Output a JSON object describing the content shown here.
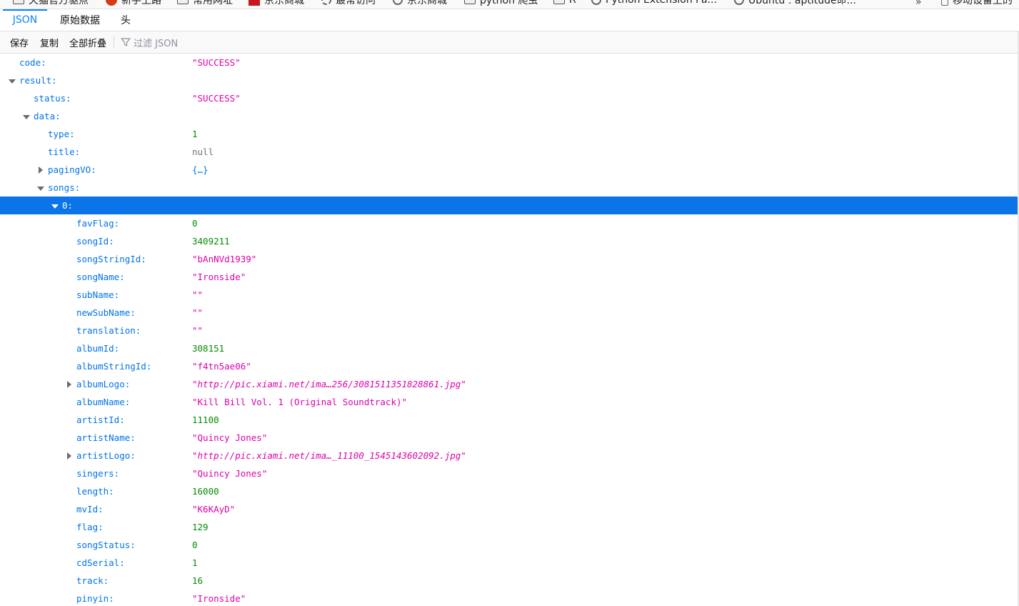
{
  "bookmarks": {
    "items": [
      {
        "label": "天猫官方驱点",
        "icon": "folder-icon"
      },
      {
        "label": "新手上路",
        "icon": "firefox-icon"
      },
      {
        "label": "常用网址",
        "icon": "folder-icon"
      },
      {
        "label": "京东商城",
        "icon": "jd-icon"
      },
      {
        "label": "最常访问",
        "icon": "gear-icon"
      },
      {
        "label": "京东商城",
        "icon": "globe-icon"
      },
      {
        "label": "python 爬虫",
        "icon": "folder-icon"
      },
      {
        "label": "R",
        "icon": "folder-icon"
      },
      {
        "label": "Python Extension Pa...",
        "icon": "globe-icon"
      },
      {
        "label": "Ubuntu : aptitude命...",
        "icon": "globe-icon"
      },
      {
        "label": "移动设备上的",
        "icon": "phone-icon"
      }
    ]
  },
  "tabs": [
    {
      "label": "JSON",
      "active": true
    },
    {
      "label": "原始数据",
      "active": false
    },
    {
      "label": "头",
      "active": false
    }
  ],
  "toolbar": {
    "save": "保存",
    "copy": "复制",
    "collapse_all": "全部折叠",
    "filter_placeholder": "过滤 JSON"
  },
  "rows": [
    {
      "key": "code:",
      "value": "\"SUCCESS\"",
      "type": "str",
      "depth": 0,
      "twisty": "none"
    },
    {
      "key": "result:",
      "value": "",
      "type": "",
      "depth": 0,
      "twisty": "open"
    },
    {
      "key": "status:",
      "value": "\"SUCCESS\"",
      "type": "str",
      "depth": 1,
      "twisty": "none"
    },
    {
      "key": "data:",
      "value": "",
      "type": "",
      "depth": 1,
      "twisty": "open"
    },
    {
      "key": "type:",
      "value": "1",
      "type": "num",
      "depth": 2,
      "twisty": "none"
    },
    {
      "key": "title:",
      "value": "null",
      "type": "null",
      "depth": 2,
      "twisty": "none"
    },
    {
      "key": "pagingVO:",
      "value": "{…}",
      "type": "obj",
      "depth": 2,
      "twisty": "closed"
    },
    {
      "key": "songs:",
      "value": "",
      "type": "",
      "depth": 2,
      "twisty": "open"
    },
    {
      "key": "0:",
      "value": "",
      "type": "",
      "depth": 3,
      "twisty": "open",
      "selected": true
    },
    {
      "key": "favFlag:",
      "value": "0",
      "type": "num",
      "depth": 4,
      "twisty": "none"
    },
    {
      "key": "songId:",
      "value": "3409211",
      "type": "num",
      "depth": 4,
      "twisty": "none"
    },
    {
      "key": "songStringId:",
      "value": "\"bAnNVd1939\"",
      "type": "str",
      "depth": 4,
      "twisty": "none"
    },
    {
      "key": "songName:",
      "value": "\"Ironside\"",
      "type": "str",
      "depth": 4,
      "twisty": "none"
    },
    {
      "key": "subName:",
      "value": "\"\"",
      "type": "str",
      "depth": 4,
      "twisty": "none"
    },
    {
      "key": "newSubName:",
      "value": "\"\"",
      "type": "str",
      "depth": 4,
      "twisty": "none"
    },
    {
      "key": "translation:",
      "value": "\"\"",
      "type": "str",
      "depth": 4,
      "twisty": "none"
    },
    {
      "key": "albumId:",
      "value": "308151",
      "type": "num",
      "depth": 4,
      "twisty": "none"
    },
    {
      "key": "albumStringId:",
      "value": "\"f4tn5ae06\"",
      "type": "str",
      "depth": 4,
      "twisty": "none"
    },
    {
      "key": "albumLogo:",
      "value": "\"http://pic.xiami.net/ima…256/3081511351828861.jpg\"",
      "type": "url",
      "depth": 4,
      "twisty": "closed"
    },
    {
      "key": "albumName:",
      "value": "\"Kill Bill Vol. 1 (Original Soundtrack)\"",
      "type": "str",
      "depth": 4,
      "twisty": "none"
    },
    {
      "key": "artistId:",
      "value": "11100",
      "type": "num",
      "depth": 4,
      "twisty": "none"
    },
    {
      "key": "artistName:",
      "value": "\"Quincy Jones\"",
      "type": "str",
      "depth": 4,
      "twisty": "none"
    },
    {
      "key": "artistLogo:",
      "value": "\"http://pic.xiami.net/ima…_11100_1545143602092.jpg\"",
      "type": "url",
      "depth": 4,
      "twisty": "closed"
    },
    {
      "key": "singers:",
      "value": "\"Quincy Jones\"",
      "type": "str",
      "depth": 4,
      "twisty": "none"
    },
    {
      "key": "length:",
      "value": "16000",
      "type": "num",
      "depth": 4,
      "twisty": "none"
    },
    {
      "key": "mvId:",
      "value": "\"K6KAyD\"",
      "type": "str",
      "depth": 4,
      "twisty": "none"
    },
    {
      "key": "flag:",
      "value": "129",
      "type": "num",
      "depth": 4,
      "twisty": "none"
    },
    {
      "key": "songStatus:",
      "value": "0",
      "type": "num",
      "depth": 4,
      "twisty": "none"
    },
    {
      "key": "cdSerial:",
      "value": "1",
      "type": "num",
      "depth": 4,
      "twisty": "none"
    },
    {
      "key": "track:",
      "value": "16",
      "type": "num",
      "depth": 4,
      "twisty": "none"
    },
    {
      "key": "pinyin:",
      "value": "\"Ironside\"",
      "type": "str",
      "depth": 4,
      "twisty": "none"
    }
  ]
}
